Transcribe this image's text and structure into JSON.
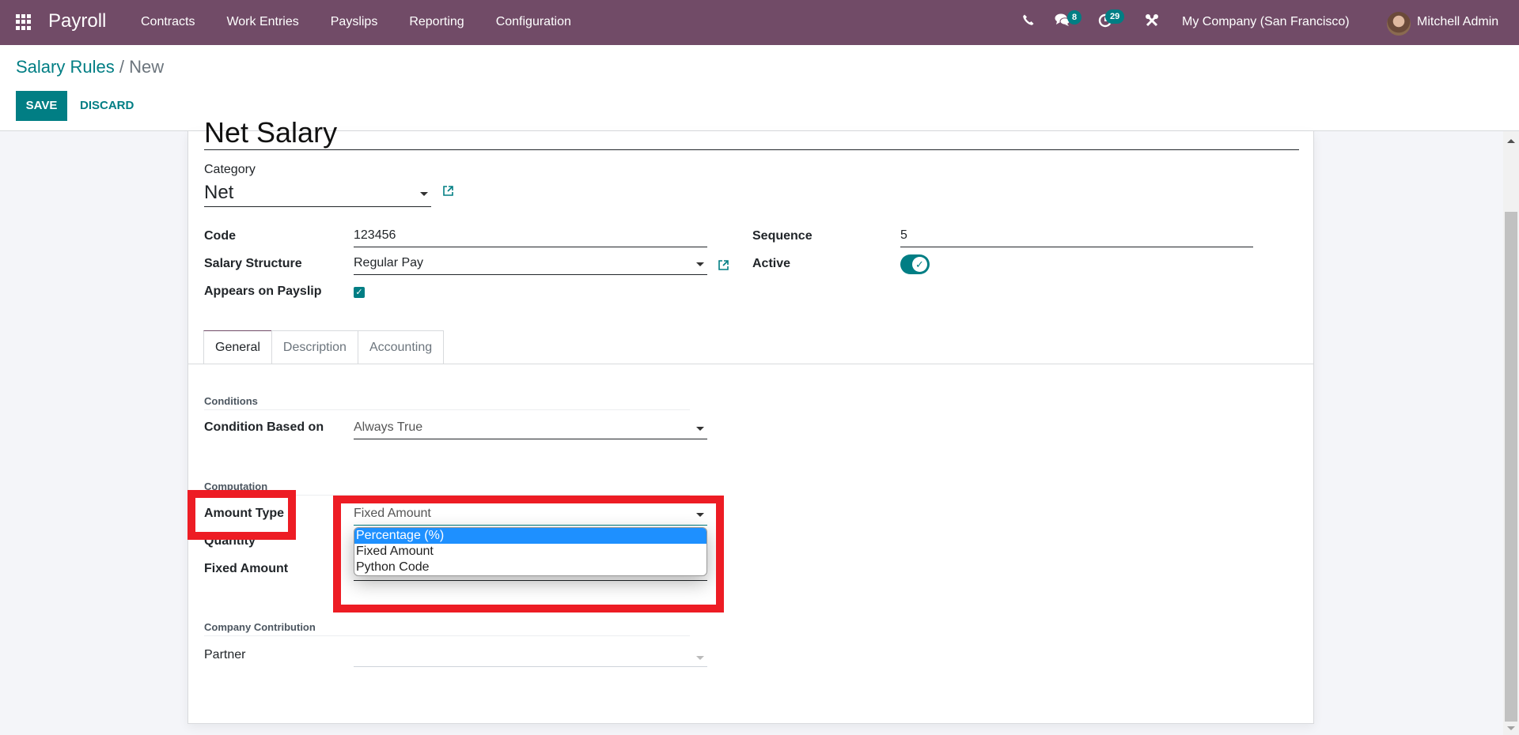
{
  "navbar": {
    "app_name": "Payroll",
    "menu": [
      "Contracts",
      "Work Entries",
      "Payslips",
      "Reporting",
      "Configuration"
    ],
    "icons": {
      "apps": "apps-grid-icon",
      "phone": "phone-icon",
      "chat": "chat-icon",
      "activity": "clock-icon",
      "debug": "tools-icon"
    },
    "chat_badge": "8",
    "activity_badge": "29",
    "company": "My Company (San Francisco)",
    "user": "Mitchell Admin"
  },
  "control_panel": {
    "breadcrumb_parent": "Salary Rules",
    "breadcrumb_sep": "/",
    "breadcrumb_current": "New",
    "save_label": "SAVE",
    "discard_label": "DISCARD"
  },
  "form": {
    "name": "Net Salary",
    "category_label": "Category",
    "category_value": "Net",
    "code_label": "Code",
    "code_value": "123456",
    "structure_label": "Salary Structure",
    "structure_value": "Regular Pay",
    "appears_label": "Appears on Payslip",
    "appears_checked": true,
    "sequence_label": "Sequence",
    "sequence_value": "5",
    "active_label": "Active",
    "active_on": true,
    "tabs": [
      "General",
      "Description",
      "Accounting"
    ],
    "active_tab": "General",
    "conditions_section": "Conditions",
    "condition_label": "Condition Based on",
    "condition_value": "Always True",
    "computation_section": "Computation",
    "amount_type_label": "Amount Type",
    "amount_type_value": "Fixed Amount",
    "amount_type_options": [
      "Percentage (%)",
      "Fixed Amount",
      "Python Code"
    ],
    "amount_type_highlighted": "Percentage (%)",
    "quantity_label": "Quantity",
    "fixed_amount_label": "Fixed Amount",
    "contribution_section": "Company Contribution",
    "partner_label": "Partner",
    "partner_value": ""
  },
  "colors": {
    "brand": "#714B67",
    "accent": "#017E84",
    "highlight_option": "#1E90FF",
    "annotation_red": "#ED1C24"
  }
}
